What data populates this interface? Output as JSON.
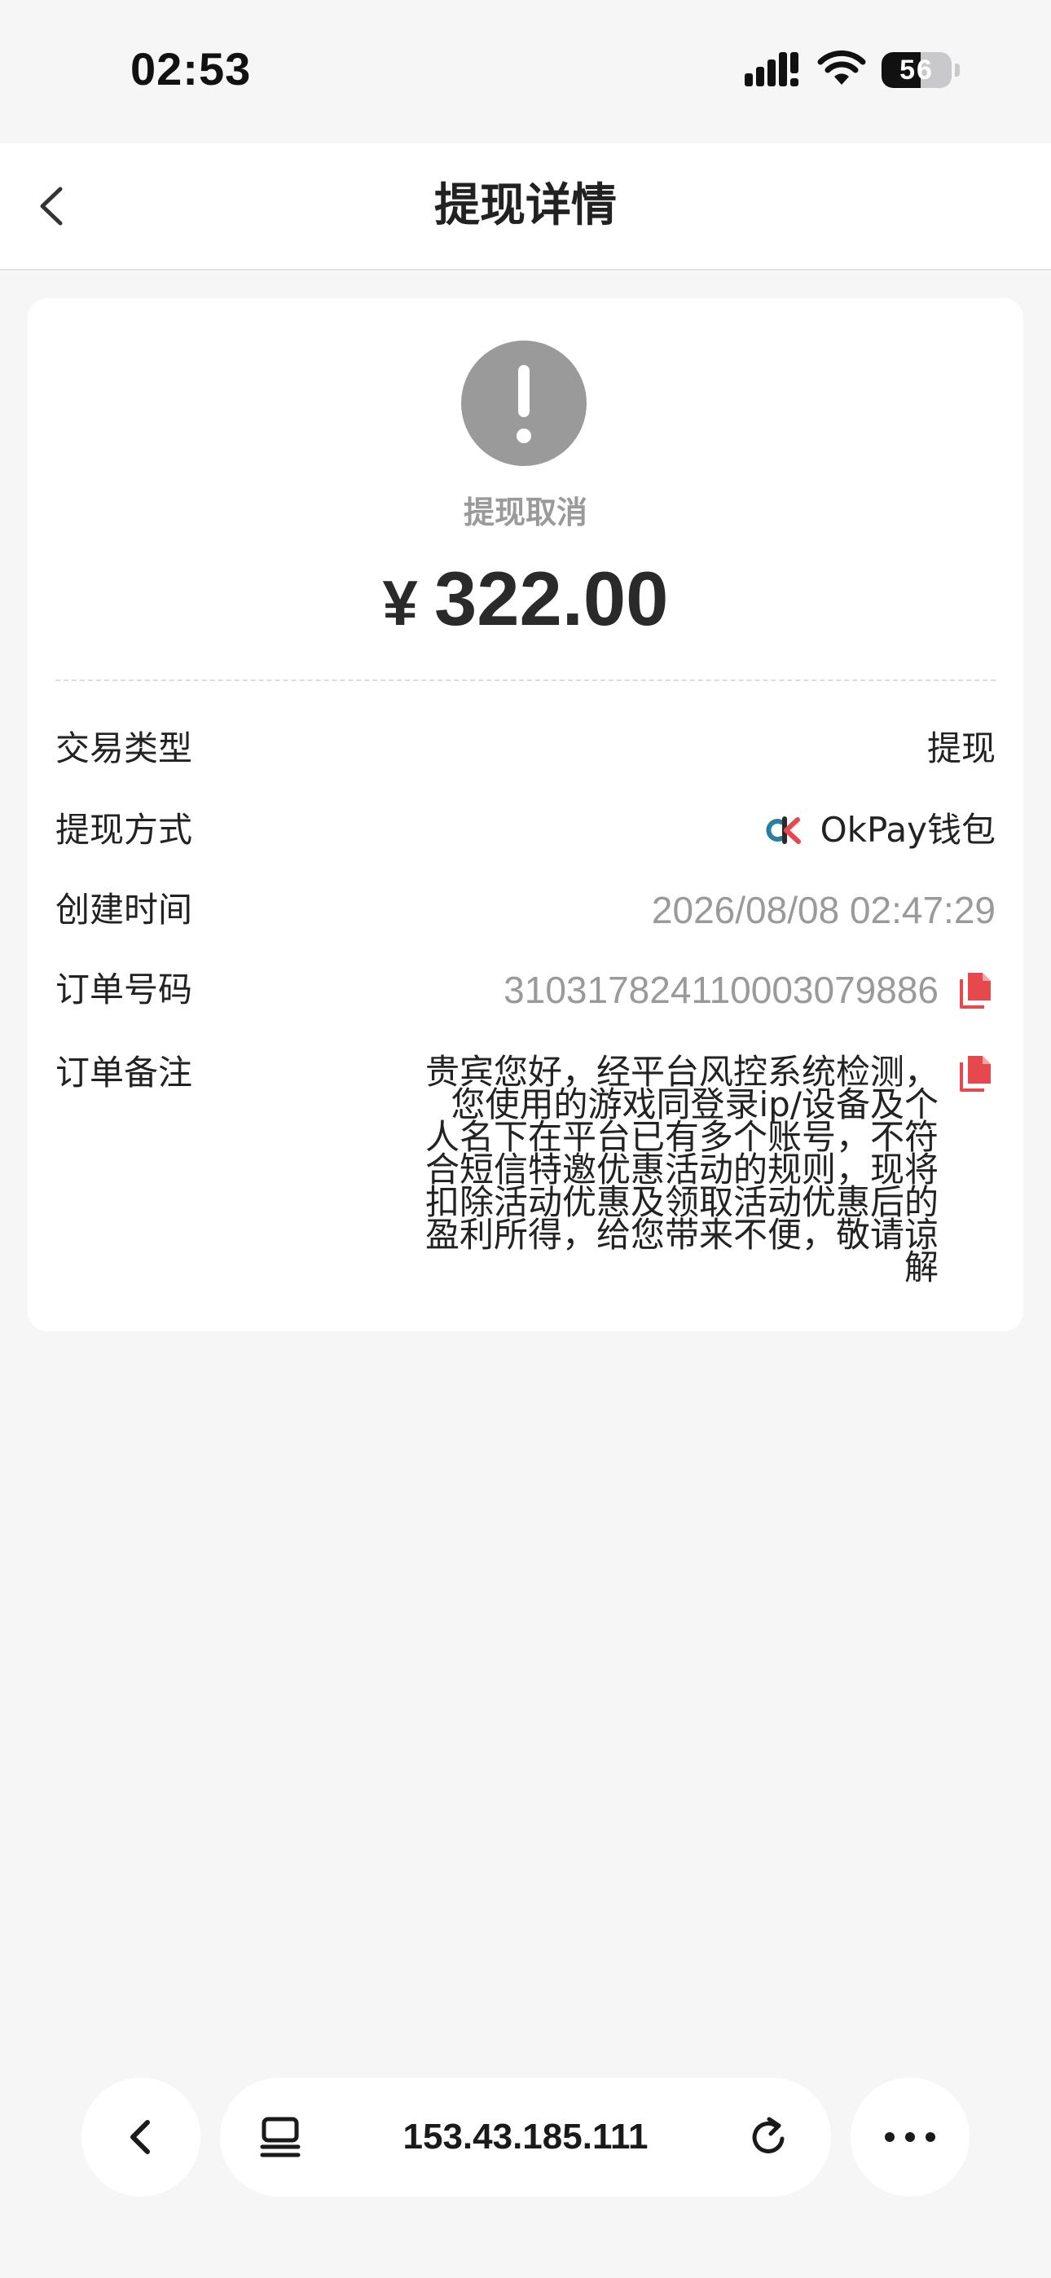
{
  "status_bar": {
    "time": "02:53",
    "battery_level": "56",
    "battery_fraction": 0.56
  },
  "header": {
    "title": "提现详情",
    "back_icon": "chevron-left-icon"
  },
  "summary": {
    "status_icon": "exclamation-icon",
    "status_text": "提现取消",
    "currency": "¥",
    "amount": "322.00",
    "status_color": "#9a9a9a"
  },
  "details": {
    "type_label": "交易类型",
    "type_value": "提现",
    "method_label": "提现方式",
    "method_value": "OkPay钱包",
    "method_icon": "okpay-logo-icon",
    "created_label": "创建时间",
    "created_value": "2026/08/08 02:47:29",
    "order_label": "订单号码",
    "order_value": "310317824110003079886",
    "note_label": "订单备注",
    "note_value": "贵宾您好，经平台风控系统检测，您使用的游戏同登录ip/设备及个人名下在平台已有多个账号，不符合短信特邀优惠活动的规则，现将扣除活动优惠及领取活动优惠后的盈利所得，给您带来不便，敬请谅解",
    "copy_icon": "copy-icon",
    "copy_icon_color": "#e5484d"
  },
  "browser": {
    "url": "153.43.185.111",
    "back_icon": "chevron-left-icon",
    "tabs_icon": "tabs-icon",
    "reload_icon": "reload-icon",
    "more_icon": "more-icon"
  }
}
